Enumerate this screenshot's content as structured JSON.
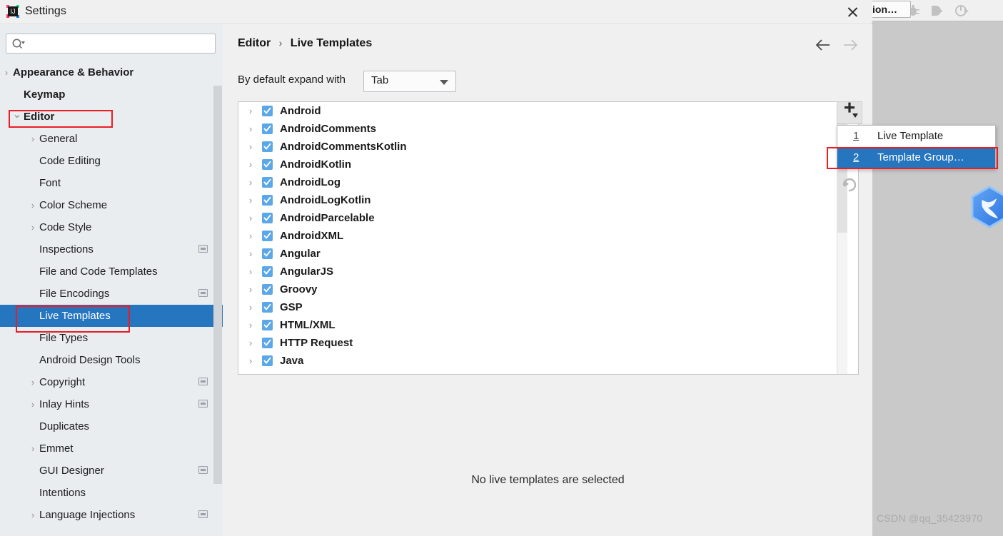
{
  "window": {
    "title": "Settings",
    "logo_icon": "intellij-idea-logo",
    "close_icon": "close-icon"
  },
  "sidebar": {
    "search": {
      "placeholder": "",
      "value": "",
      "icon": "search-icon"
    },
    "items": [
      {
        "label": "Appearance & Behavior",
        "indent": 18,
        "arrow": "chevron-right",
        "bold": true,
        "selected": false,
        "badge": false
      },
      {
        "label": "Keymap",
        "indent": 33,
        "arrow": "",
        "bold": true,
        "selected": false,
        "badge": false
      },
      {
        "label": "Editor",
        "indent": 33,
        "arrow": "chevron-down",
        "bold": true,
        "selected": false,
        "badge": false
      },
      {
        "label": "General",
        "indent": 55,
        "arrow": "chevron-right",
        "bold": false,
        "selected": false,
        "badge": false
      },
      {
        "label": "Code Editing",
        "indent": 55,
        "arrow": "",
        "bold": false,
        "selected": false,
        "badge": false
      },
      {
        "label": "Font",
        "indent": 55,
        "arrow": "",
        "bold": false,
        "selected": false,
        "badge": false
      },
      {
        "label": "Color Scheme",
        "indent": 55,
        "arrow": "chevron-right",
        "bold": false,
        "selected": false,
        "badge": false
      },
      {
        "label": "Code Style",
        "indent": 55,
        "arrow": "chevron-right",
        "bold": false,
        "selected": false,
        "badge": false
      },
      {
        "label": "Inspections",
        "indent": 55,
        "arrow": "",
        "bold": false,
        "selected": false,
        "badge": true
      },
      {
        "label": "File and Code Templates",
        "indent": 55,
        "arrow": "",
        "bold": false,
        "selected": false,
        "badge": false
      },
      {
        "label": "File Encodings",
        "indent": 55,
        "arrow": "",
        "bold": false,
        "selected": false,
        "badge": true
      },
      {
        "label": "Live Templates",
        "indent": 55,
        "arrow": "",
        "bold": false,
        "selected": true,
        "badge": false
      },
      {
        "label": "File Types",
        "indent": 55,
        "arrow": "",
        "bold": false,
        "selected": false,
        "badge": false
      },
      {
        "label": "Android Design Tools",
        "indent": 55,
        "arrow": "",
        "bold": false,
        "selected": false,
        "badge": false
      },
      {
        "label": "Copyright",
        "indent": 55,
        "arrow": "chevron-right",
        "bold": false,
        "selected": false,
        "badge": true
      },
      {
        "label": "Inlay Hints",
        "indent": 55,
        "arrow": "chevron-right",
        "bold": false,
        "selected": false,
        "badge": true
      },
      {
        "label": "Duplicates",
        "indent": 55,
        "arrow": "",
        "bold": false,
        "selected": false,
        "badge": false
      },
      {
        "label": "Emmet",
        "indent": 55,
        "arrow": "chevron-right",
        "bold": false,
        "selected": false,
        "badge": false
      },
      {
        "label": "GUI Designer",
        "indent": 55,
        "arrow": "",
        "bold": false,
        "selected": false,
        "badge": true
      },
      {
        "label": "Intentions",
        "indent": 55,
        "arrow": "",
        "bold": false,
        "selected": false,
        "badge": false
      },
      {
        "label": "Language Injections",
        "indent": 55,
        "arrow": "chevron-right",
        "bold": false,
        "selected": false,
        "badge": true
      }
    ]
  },
  "main": {
    "breadcrumb": {
      "parent": "Editor",
      "separator": "›",
      "current": "Live Templates"
    },
    "nav": {
      "back_icon": "arrow-left-icon",
      "forward_icon": "arrow-right-icon"
    },
    "expand_with": {
      "label": "By default expand with",
      "value": "Tab",
      "caret_icon": "chevron-down-icon"
    },
    "empty_message": "No live templates are selected",
    "template_groups": [
      {
        "name": "Android",
        "checked": true
      },
      {
        "name": "AndroidComments",
        "checked": true
      },
      {
        "name": "AndroidCommentsKotlin",
        "checked": true
      },
      {
        "name": "AndroidKotlin",
        "checked": true
      },
      {
        "name": "AndroidLog",
        "checked": true
      },
      {
        "name": "AndroidLogKotlin",
        "checked": true
      },
      {
        "name": "AndroidParcelable",
        "checked": true
      },
      {
        "name": "AndroidXML",
        "checked": true
      },
      {
        "name": "Angular",
        "checked": true
      },
      {
        "name": "AngularJS",
        "checked": true
      },
      {
        "name": "Groovy",
        "checked": true
      },
      {
        "name": "GSP",
        "checked": true
      },
      {
        "name": "HTML/XML",
        "checked": true
      },
      {
        "name": "HTTP Request",
        "checked": true
      },
      {
        "name": "Java",
        "checked": true
      }
    ],
    "tools": {
      "add_icon": "plus-dropdown-icon",
      "revert_icon": "undo-arrow-icon"
    }
  },
  "popup_menu": {
    "items": [
      {
        "mnemonic": "1",
        "label": "Live Template",
        "selected": false
      },
      {
        "mnemonic": "2",
        "label": "Template Group…",
        "selected": true
      }
    ]
  },
  "ide": {
    "run_config": "ion…",
    "toolbar_icons": [
      "run-icon",
      "debug-icon",
      "run-with-coverage-icon",
      "profile-icon"
    ],
    "logo_icon": "qq-bird-logo",
    "watermark": "CSDN @qq_35423970"
  },
  "colors": {
    "accent": "#2675bf",
    "annotation": "#ec1c24",
    "checkbox": "#5ba7e8",
    "sidebar_bg": "#e9edf0",
    "panel_bg": "#f0f0f0"
  }
}
